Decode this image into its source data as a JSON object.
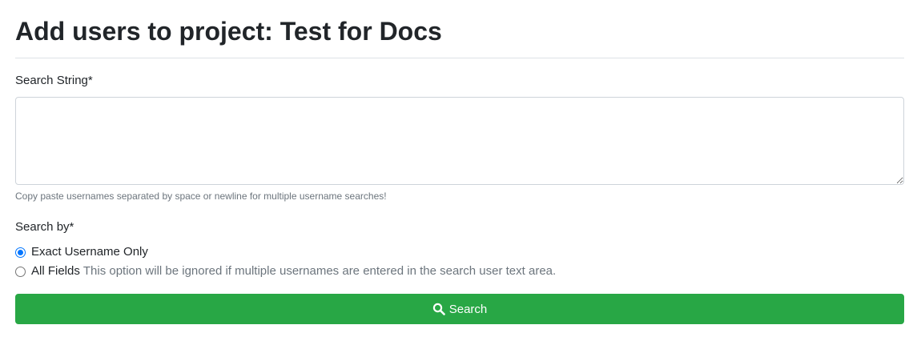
{
  "page": {
    "title": "Add users to project: Test for Docs"
  },
  "form": {
    "search_string_label": "Search String*",
    "search_string_value": "",
    "search_string_help": "Copy paste usernames separated by space or newline for multiple username searches!",
    "search_by_label": "Search by*",
    "options": [
      {
        "label": "Exact Username Only",
        "note": "",
        "checked": true
      },
      {
        "label": "All Fields",
        "note": "This option will be ignored if multiple usernames are entered in the search user text area.",
        "checked": false
      }
    ],
    "submit_label": "Search",
    "submit_icon": "search-icon"
  },
  "colors": {
    "primary_text": "#212529",
    "muted_text": "#6c757d",
    "button_green": "#28a745",
    "radio_blue": "#0075ff",
    "border": "#ced4da"
  }
}
